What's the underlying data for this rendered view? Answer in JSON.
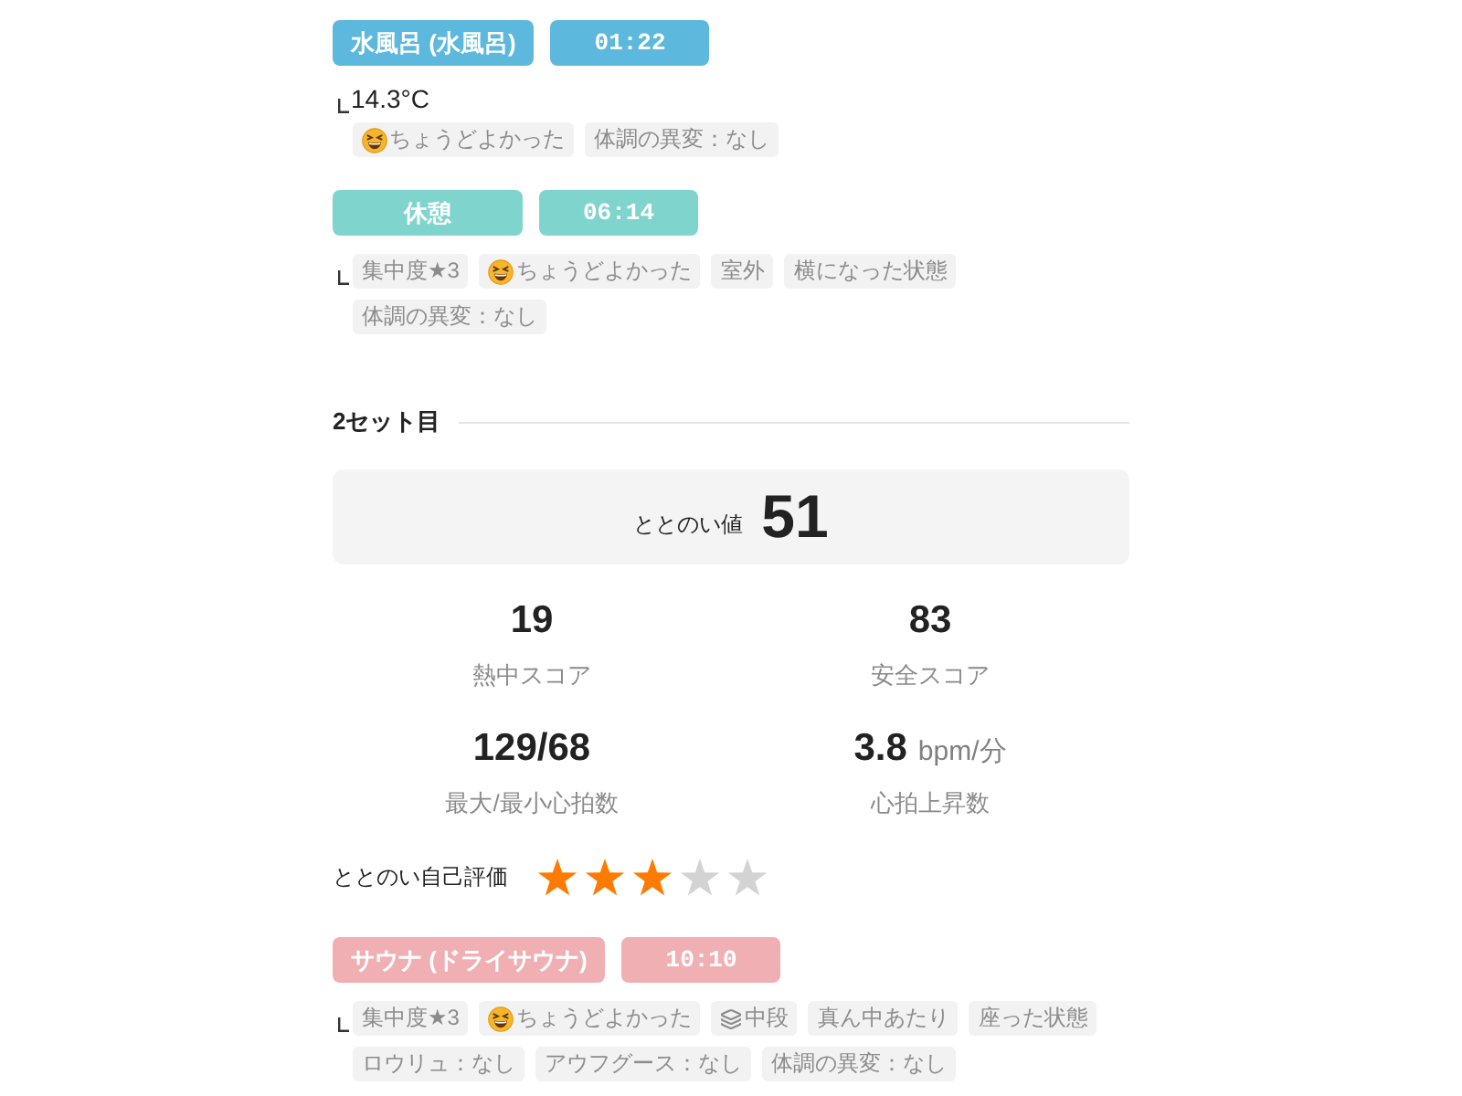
{
  "steps": [
    {
      "label": "水風呂 (水風呂)",
      "time": "01:22",
      "color": "#5cb8dc",
      "detail": "14.3°C",
      "tags": [
        {
          "kind": "feeling",
          "text": "ちょうどよかった"
        },
        {
          "kind": "plain",
          "text": "体調の異変：なし"
        }
      ]
    },
    {
      "label": "休憩",
      "time": "06:14",
      "color": "#7fd4cd",
      "tags": [
        {
          "kind": "plain",
          "text": "集中度★3"
        },
        {
          "kind": "feeling",
          "text": "ちょうどよかった"
        },
        {
          "kind": "plain",
          "text": "室外"
        },
        {
          "kind": "plain",
          "text": "横になった状態"
        },
        {
          "kind": "plain",
          "text": "体調の異変：なし"
        }
      ]
    }
  ],
  "set": {
    "title": "2セット目",
    "score": {
      "label": "ととのい値",
      "value": "51"
    },
    "stats": [
      {
        "value": "19",
        "label": "熱中スコア"
      },
      {
        "value": "83",
        "label": "安全スコア"
      },
      {
        "value": "129/68",
        "label": "最大/最小心拍数"
      },
      {
        "value": "3.8",
        "unit": "bpm/分",
        "label": "心拍上昇数"
      }
    ],
    "rating": {
      "label": "ととのい自己評価",
      "stars": 3
    },
    "steps": [
      {
        "label": "サウナ (ドライサウナ)",
        "time": "10:10",
        "color": "#f0b0b3",
        "tags": [
          {
            "kind": "plain",
            "text": "集中度★3"
          },
          {
            "kind": "feeling",
            "text": "ちょうどよかった"
          },
          {
            "kind": "position",
            "text": "中段"
          },
          {
            "kind": "plain",
            "text": "真ん中あたり"
          },
          {
            "kind": "plain",
            "text": "座った状態"
          },
          {
            "kind": "plain",
            "text": "ロウリュ：なし"
          },
          {
            "kind": "plain",
            "text": "アウフグース：なし"
          },
          {
            "kind": "plain",
            "text": "体調の異変：なし"
          }
        ]
      }
    ]
  }
}
